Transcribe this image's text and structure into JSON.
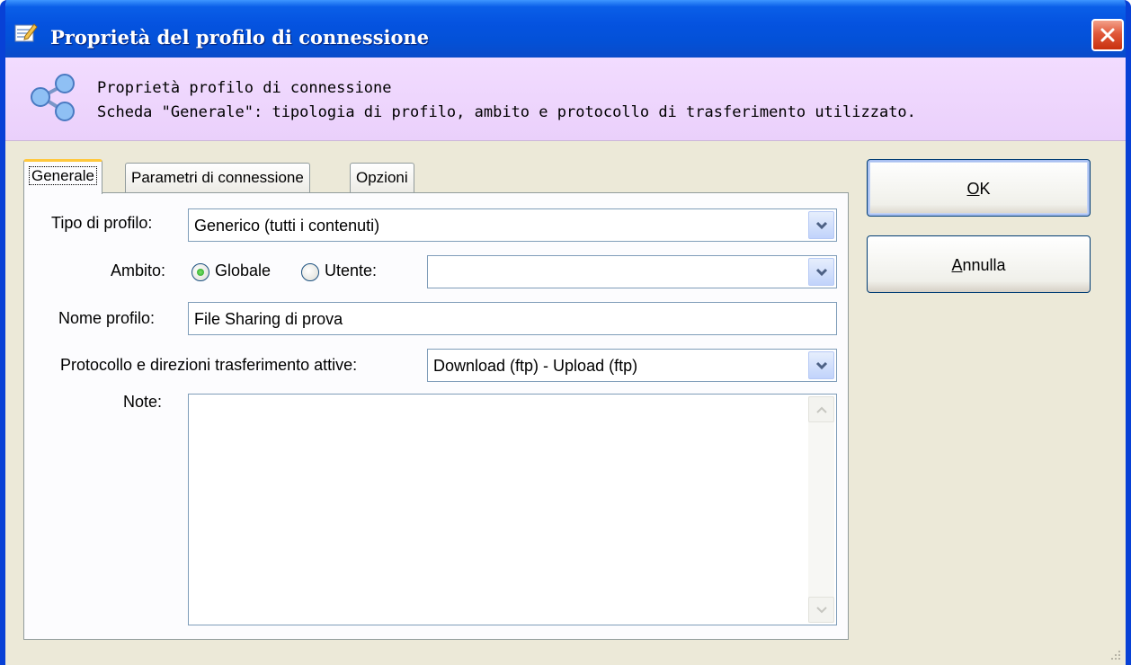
{
  "window": {
    "title": "Proprietà del profilo di connessione"
  },
  "header": {
    "line1": "Proprietà profilo di connessione",
    "line2": "Scheda \"Generale\": tipologia di profilo, ambito e protocollo di trasferimento utilizzato.",
    "icon": "share-icon"
  },
  "tabs": [
    {
      "label": "Generale",
      "active": true
    },
    {
      "label": "Parametri di connessione",
      "active": false
    },
    {
      "label": "Opzioni",
      "active": false
    }
  ],
  "form": {
    "tipo_label": "Tipo di profilo:",
    "tipo_value": "Generico (tutti i contenuti)",
    "ambito_label": "Ambito:",
    "globale_label": "Globale",
    "globale_selected": true,
    "utente_label": "Utente:",
    "utente_selected": false,
    "utente_value": "",
    "nome_label": "Nome profilo:",
    "nome_value": "File Sharing di prova",
    "protocollo_label": "Protocollo e direzioni trasferimento attive:",
    "protocollo_value": "Download (ftp) - Upload (ftp)",
    "note_label": "Note:",
    "note_value": ""
  },
  "buttons": {
    "ok": "OK",
    "cancel": "Annulla"
  },
  "colors": {
    "titlebar": "#0553e0",
    "header_bg": "#f2dcff",
    "dialog_bg": "#ece9d8",
    "close_button": "#e0593a"
  }
}
